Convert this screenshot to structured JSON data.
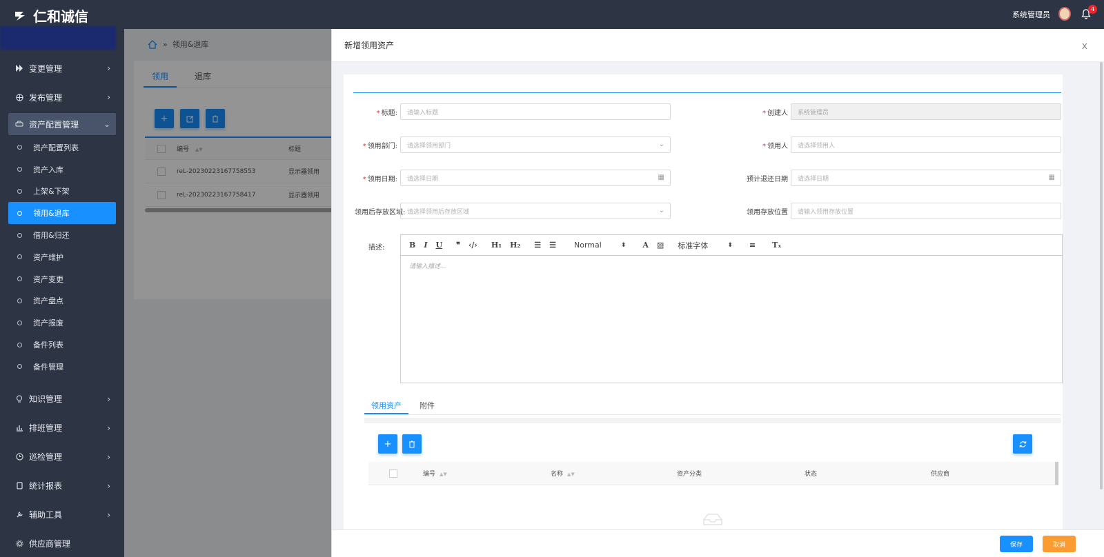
{
  "app": {
    "logo_text": "仁和诚信"
  },
  "topbar": {
    "user_name": "系统管理员",
    "notification_count": "4"
  },
  "sidebar": {
    "items_top": [
      {
        "label": "变更管理",
        "icon": "fast-forward-icon"
      },
      {
        "label": "发布管理",
        "icon": "globe-icon"
      }
    ],
    "open_item": {
      "label": "资产配置管理",
      "icon": "car-icon"
    },
    "sub_items": [
      "资产配置列表",
      "资产入库",
      "上架&下架",
      "领用&退库",
      "借用&归还",
      "资产维护",
      "资产变更",
      "资产盘点",
      "资产报废",
      "备件列表",
      "备件管理"
    ],
    "active_sub": "领用&退库",
    "items_bottom": [
      {
        "label": "知识管理",
        "icon": "bulb-icon"
      },
      {
        "label": "排班管理",
        "icon": "chart-icon"
      },
      {
        "label": "巡检管理",
        "icon": "clock-icon"
      },
      {
        "label": "统计报表",
        "icon": "doc-icon"
      },
      {
        "label": "辅助工具",
        "icon": "tool-icon"
      },
      {
        "label": "供应商管理",
        "icon": "gear-icon"
      }
    ]
  },
  "background_page": {
    "breadcrumb_sep": "»",
    "breadcrumb_current": "领用&退库",
    "tabs": [
      "领用",
      "退库"
    ],
    "table_headers": [
      "编号",
      "标题"
    ],
    "rows": [
      {
        "id": "reL-20230223167758553",
        "title": "显示器领用"
      },
      {
        "id": "reL-20230223167758417",
        "title": "显示器领用"
      }
    ]
  },
  "drawer": {
    "title": "新增领用资产",
    "close": "x",
    "fields": {
      "title_label": "标题:",
      "title_placeholder": "请输入标题",
      "creator_label": "创建人",
      "creator_value": "系统管理员",
      "dept_label": "领用部门:",
      "dept_placeholder": "请选择领用部门",
      "receiver_label": "领用人",
      "receiver_placeholder": "请选择领用人",
      "date_label": "领用日期:",
      "date_placeholder": "请选择日期",
      "return_label": "预计退还日期",
      "return_placeholder": "请选择日期",
      "area_label": "领用后存放区域:",
      "area_placeholder": "请选择领用后存放区域",
      "location_label": "领用存放位置",
      "location_placeholder": "请输入领用存放位置",
      "desc_label": "描述:",
      "desc_placeholder": "请输入描述..."
    },
    "editor": {
      "format": "Normal",
      "font": "标准字体"
    },
    "subtabs": [
      "领用资产",
      "附件"
    ],
    "table_headers": [
      "编号",
      "名称",
      "资产分类",
      "状态",
      "供应商"
    ],
    "footer": {
      "save": "保存",
      "cancel": "取消"
    }
  }
}
